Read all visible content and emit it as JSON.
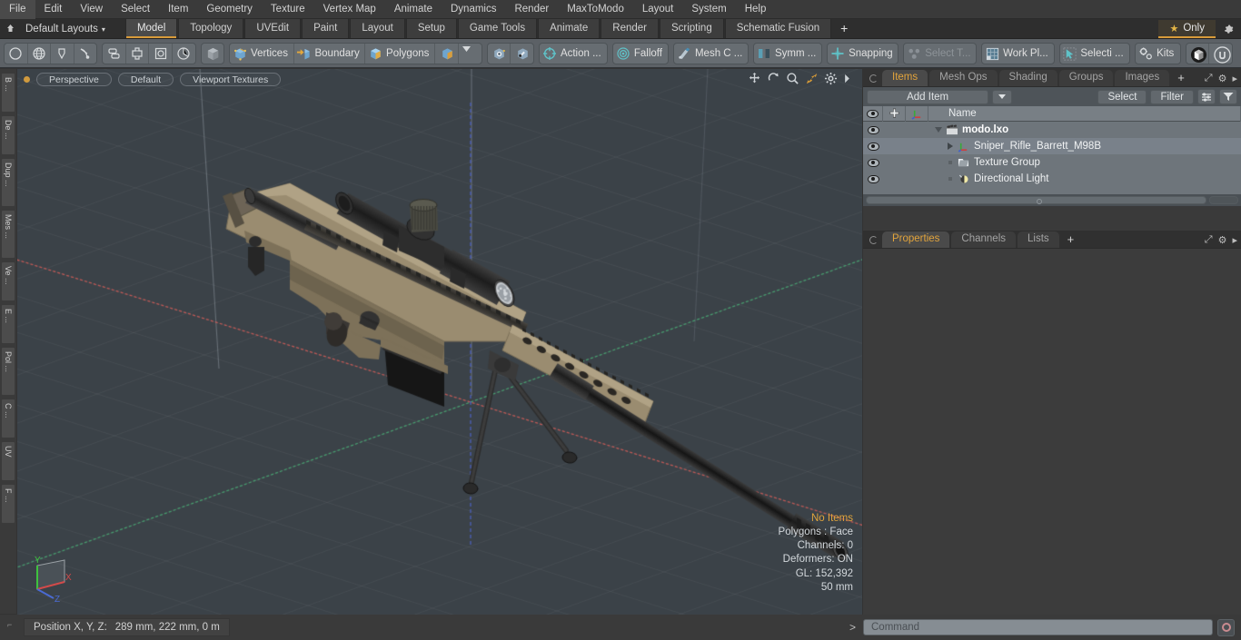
{
  "app": {
    "title": "modo"
  },
  "menubar": {
    "items": [
      {
        "label": "File"
      },
      {
        "label": "Edit"
      },
      {
        "label": "View"
      },
      {
        "label": "Select"
      },
      {
        "label": "Item"
      },
      {
        "label": "Geometry"
      },
      {
        "label": "Texture"
      },
      {
        "label": "Vertex Map"
      },
      {
        "label": "Animate"
      },
      {
        "label": "Dynamics"
      },
      {
        "label": "Render"
      },
      {
        "label": "MaxToModo"
      },
      {
        "label": "Layout"
      },
      {
        "label": "System"
      },
      {
        "label": "Help"
      }
    ]
  },
  "layoutbar": {
    "home_icon": "home-icon",
    "layout_name": "Default Layouts",
    "dropdown_caret": "▾",
    "tabs": [
      {
        "label": "Model",
        "active": true
      },
      {
        "label": "Topology",
        "active": false
      },
      {
        "label": "UVEdit",
        "active": false
      },
      {
        "label": "Paint",
        "active": false
      },
      {
        "label": "Layout",
        "active": false
      },
      {
        "label": "Setup",
        "active": false
      },
      {
        "label": "Game Tools",
        "active": false
      },
      {
        "label": "Animate",
        "active": false
      },
      {
        "label": "Render",
        "active": false
      },
      {
        "label": "Scripting",
        "active": false
      },
      {
        "label": "Schematic Fusion",
        "active": false
      }
    ],
    "add_tab": "+",
    "only_label": "Only",
    "only_star": "★",
    "gear": "⚙"
  },
  "toolbar": {
    "groups": [
      {
        "name": "primitives",
        "buttons": [
          {
            "icon": "circle-icon",
            "label": ""
          },
          {
            "icon": "globe-icon",
            "label": ""
          },
          {
            "icon": "pen-icon",
            "label": ""
          },
          {
            "icon": "curve-icon",
            "label": ""
          }
        ]
      },
      {
        "name": "duplicate",
        "buttons": [
          {
            "icon": "array-icon",
            "label": ""
          },
          {
            "icon": "mirror-icon",
            "label": ""
          },
          {
            "icon": "bound-icon",
            "label": ""
          },
          {
            "icon": "radial-icon",
            "label": ""
          }
        ]
      },
      {
        "name": "selection-modes",
        "buttons": [
          {
            "icon": "cube-gray-icon",
            "label": ""
          }
        ]
      },
      {
        "name": "component-modes",
        "buttons": [
          {
            "icon": "vertices-icon",
            "label": "Vertices"
          },
          {
            "icon": "boundary-icon",
            "label": "Boundary"
          },
          {
            "icon": "polygons-icon",
            "label": "Polygons"
          },
          {
            "icon": "materials-icon",
            "label": ""
          },
          {
            "icon": "chevron-down-icon",
            "label": ""
          }
        ]
      },
      {
        "name": "falloff-group",
        "buttons": [
          {
            "icon": "snap-cube-icon",
            "label": ""
          },
          {
            "icon": "snap-cube2-icon",
            "label": ""
          }
        ]
      },
      {
        "name": "action-center",
        "buttons": [
          {
            "icon": "action-center-icon",
            "label": "Action  ..."
          }
        ]
      },
      {
        "name": "falloff",
        "buttons": [
          {
            "icon": "falloff-icon",
            "label": "Falloff"
          }
        ]
      },
      {
        "name": "mesh-constraint",
        "buttons": [
          {
            "icon": "mesh-constraint-icon",
            "label": "Mesh C ..."
          }
        ]
      },
      {
        "name": "symmetry",
        "buttons": [
          {
            "icon": "symmetry-icon",
            "label": "Symm ..."
          }
        ]
      },
      {
        "name": "snapping",
        "buttons": [
          {
            "icon": "snapping-icon",
            "label": "Snapping"
          }
        ]
      },
      {
        "name": "select-through",
        "buttons": [
          {
            "icon": "select-through-icon",
            "label": "Select T...",
            "dim": true
          }
        ]
      },
      {
        "name": "work-plane",
        "buttons": [
          {
            "icon": "work-plane-icon",
            "label": "Work Pl..."
          }
        ]
      },
      {
        "name": "selection-set",
        "buttons": [
          {
            "icon": "selection-icon",
            "label": "Selecti ..."
          }
        ]
      },
      {
        "name": "kits",
        "buttons": [
          {
            "icon": "kits-icon",
            "label": "Kits"
          }
        ]
      },
      {
        "name": "engines",
        "buttons": [
          {
            "icon": "package-icon",
            "label": ""
          },
          {
            "icon": "unreal-icon",
            "label": ""
          }
        ]
      }
    ]
  },
  "left_tabs": [
    {
      "label": "B ..."
    },
    {
      "label": "De ..."
    },
    {
      "label": "Dup ..."
    },
    {
      "label": "Mes ..."
    },
    {
      "label": "Ve ..."
    },
    {
      "label": "E ..."
    },
    {
      "label": "Pol ..."
    },
    {
      "label": "C ..."
    },
    {
      "label": "UV"
    },
    {
      "label": "F ..."
    }
  ],
  "viewport": {
    "pills": [
      {
        "label": "Perspective"
      },
      {
        "label": "Default"
      },
      {
        "label": "Viewport Textures"
      }
    ],
    "nav_icons": [
      {
        "name": "pan-icon"
      },
      {
        "name": "rotate-icon"
      },
      {
        "name": "zoom-icon"
      },
      {
        "name": "fit-icon"
      },
      {
        "name": "viewport-settings-icon"
      },
      {
        "name": "viewport-more-icon"
      }
    ],
    "stats": {
      "selection": "No Items",
      "polygons": "Polygons : Face",
      "channels": "Channels: 0",
      "deformers": "Deformers: ON",
      "gl": "GL: 152,392",
      "grid": "50 mm"
    },
    "axis_labels": {
      "x": "X",
      "y": "Y",
      "z": "Z"
    },
    "colors": {
      "background": "#3b4248",
      "x_axis": "#c05050",
      "y_axis": "#5a8fd0",
      "z_axis": "#3f9e6f",
      "model_body": "#8a7b62",
      "model_dark": "#2a2a2a"
    },
    "model_name": "Sniper_Rifle_Barrett_M98B"
  },
  "right_panel": {
    "top_tabs": [
      {
        "label": "Items",
        "active": true
      },
      {
        "label": "Mesh Ops",
        "active": false
      },
      {
        "label": "Shading",
        "active": false
      },
      {
        "label": "Groups",
        "active": false
      },
      {
        "label": "Images",
        "active": false
      },
      {
        "label": "+",
        "active": false
      }
    ],
    "toolrow": {
      "add_item": "Add Item",
      "add_item_caret": "▾",
      "select": "Select",
      "filter": "Filter",
      "list_icon": "list-options-icon",
      "funnel_icon": "funnel-icon"
    },
    "columns": {
      "eye": "eye-icon",
      "lock": "add-icon",
      "axis": "axis-icon",
      "name": "Name"
    },
    "tree": [
      {
        "label": "modo.lxo",
        "icon": "scene-icon",
        "indent": 0,
        "bold": true,
        "twirl": "down"
      },
      {
        "label": "Sniper_Rifle_Barrett_M98B",
        "icon": "mesh-icon",
        "indent": 1,
        "bold": false,
        "twirl": "right"
      },
      {
        "label": "Texture Group",
        "icon": "texture-group-icon",
        "indent": 1,
        "bold": false,
        "twirl": "none"
      },
      {
        "label": "Directional Light",
        "icon": "light-icon",
        "indent": 1,
        "bold": false,
        "twirl": "none"
      }
    ],
    "bottom_tabs": [
      {
        "label": "Properties",
        "active": true
      },
      {
        "label": "Channels",
        "active": false
      },
      {
        "label": "Lists",
        "active": false
      },
      {
        "label": "+",
        "active": false
      }
    ],
    "header_icons": [
      {
        "name": "expand-icon",
        "glyph": "⤢"
      },
      {
        "name": "gear-icon",
        "glyph": "⚙"
      },
      {
        "name": "more-icon",
        "glyph": "▸"
      }
    ]
  },
  "statusbar": {
    "position_label": "Position X, Y, Z:",
    "position_value": "289 mm, 222 mm, 0 m",
    "command_caret": ">",
    "command_placeholder": "Command",
    "record_icon": "record-icon"
  }
}
